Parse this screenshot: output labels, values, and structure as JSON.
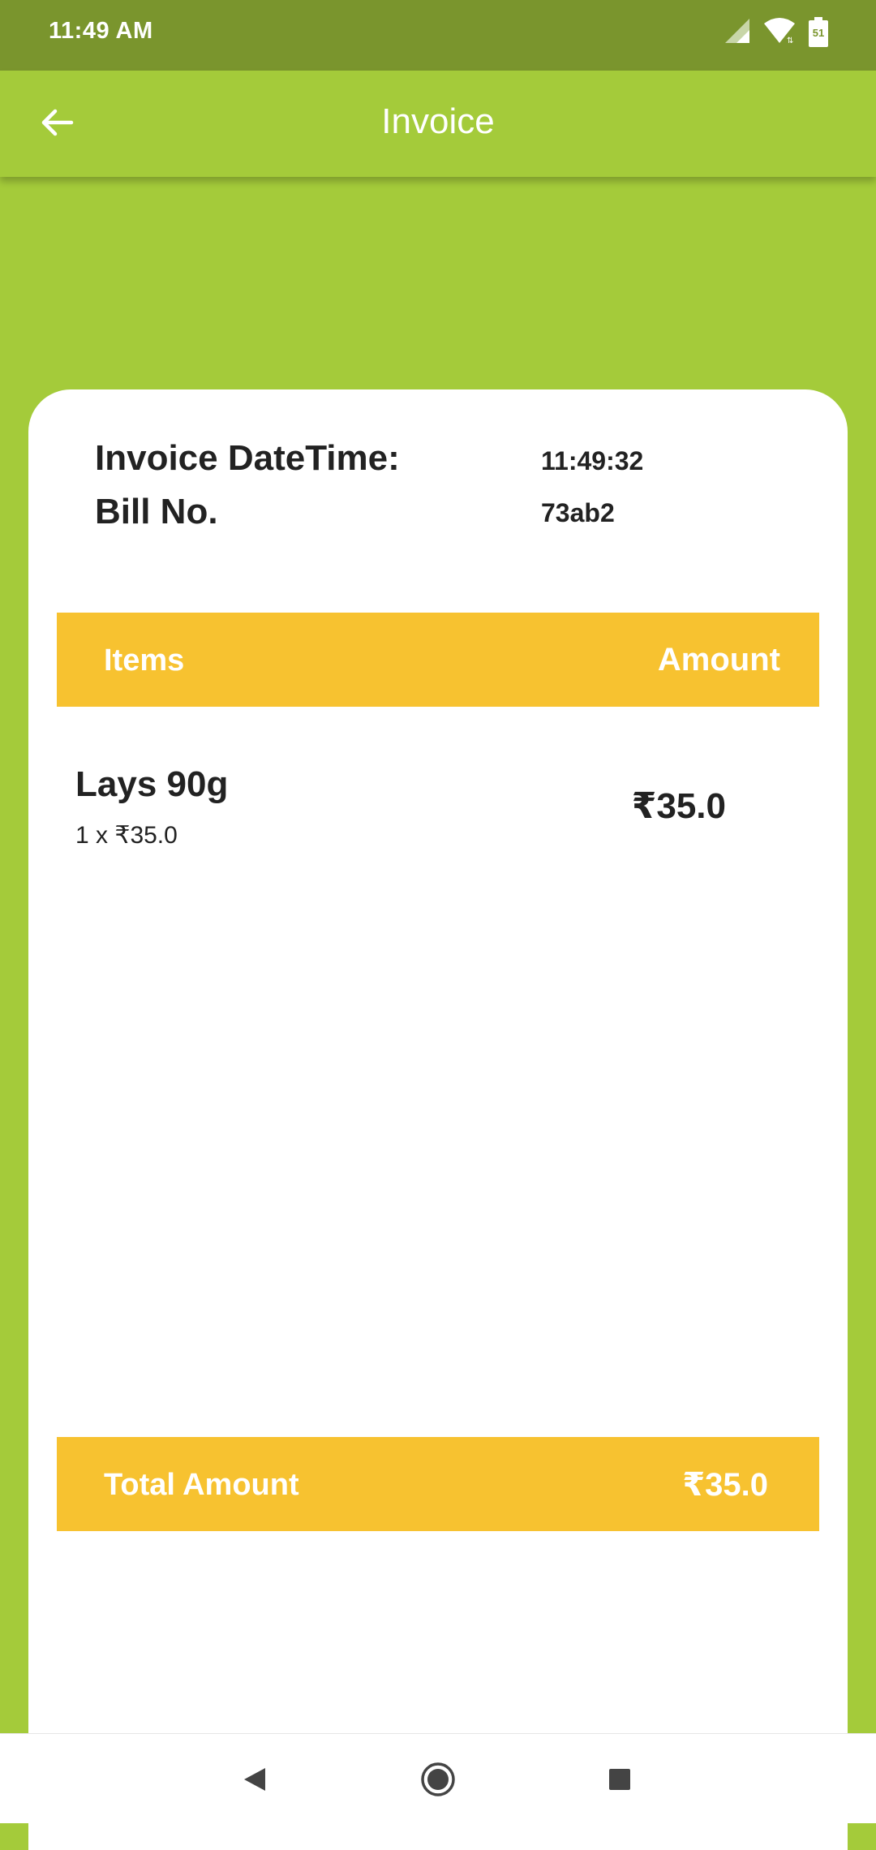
{
  "status_bar": {
    "time": "11:49 AM",
    "battery_level": "51",
    "icons": [
      "signal-icon",
      "wifi-icon",
      "battery-icon"
    ]
  },
  "app_bar": {
    "title": "Invoice",
    "back_icon": "arrow-left-icon"
  },
  "invoice": {
    "datetime_label": "Invoice DateTime:",
    "datetime_value": "11:49:32",
    "bill_label": "Bill No.",
    "bill_value": "73ab2"
  },
  "table": {
    "header_items": "Items",
    "header_amount": "Amount",
    "rows": [
      {
        "name": "Lays 90g",
        "qty_price": "1 x  ₹35.0",
        "amount": "₹35.0"
      }
    ]
  },
  "total": {
    "label": "Total Amount",
    "value": "₹35.0"
  },
  "nav": {
    "icons": [
      "back-triangle-icon",
      "home-circle-icon",
      "recents-square-icon"
    ]
  },
  "colors": {
    "primary": "#a4cb3a",
    "status_bar": "#7a952d",
    "accent": "#f7c230",
    "card": "#ffffff"
  }
}
